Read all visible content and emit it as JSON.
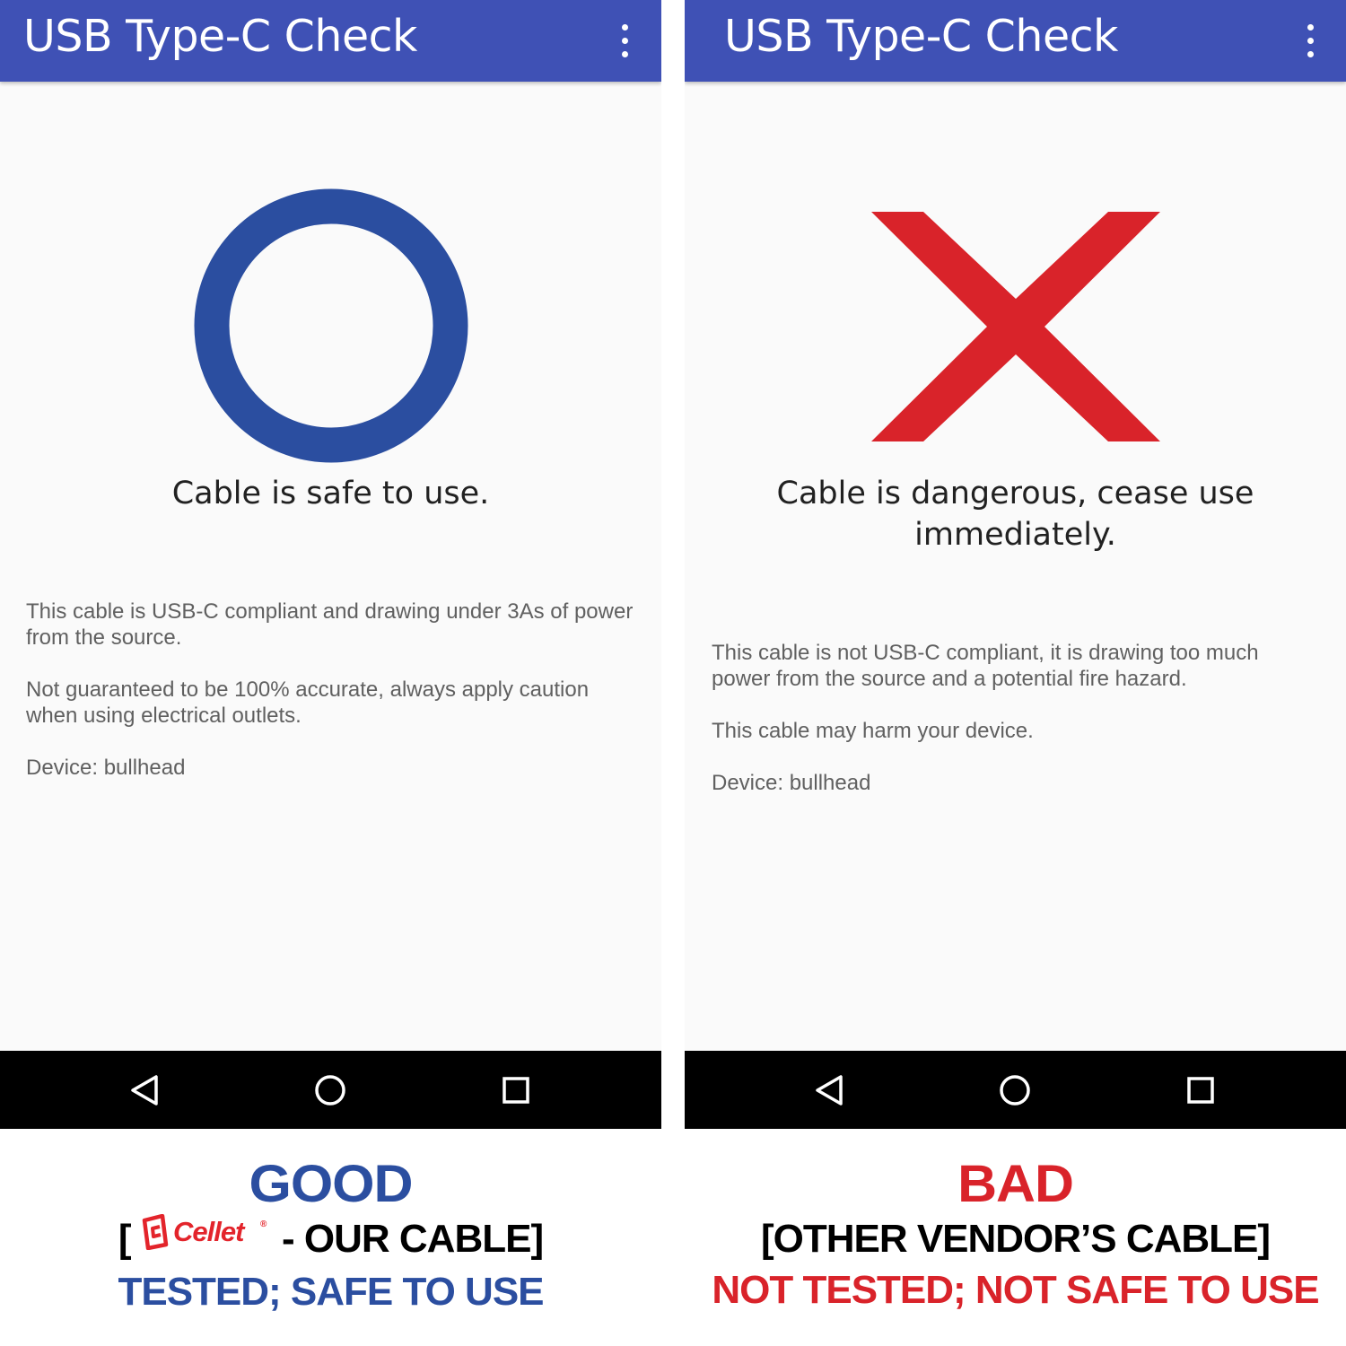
{
  "left_screen": {
    "app_title": "USB Type-C Check",
    "status_icon": "ring-icon",
    "status_color": "#2b4ea0",
    "headline": "Cable is safe to use.",
    "info": [
      "This cable is USB-C compliant and drawing under 3As of power from the source.",
      "Not guaranteed to be 100% accurate, always apply caution when using electrical outlets.",
      "Device: bullhead"
    ]
  },
  "right_screen": {
    "app_title": "USB Type-C Check",
    "status_icon": "cross-icon",
    "status_color": "#d9232a",
    "headline": "Cable is dangerous, cease use immediately.",
    "info": [
      "This cable is not USB-C compliant, it is drawing too much power from the source and a potential fire hazard.",
      "This cable may harm your device.",
      "Device: bullhead"
    ]
  },
  "theme": {
    "app_bar": "#3f51b5",
    "background": "#fafafa",
    "nav_bar": "#000000"
  },
  "nav_icons": [
    "back-icon",
    "home-icon",
    "recents-icon"
  ],
  "captions": {
    "good": {
      "title": "GOOD",
      "bracket_open": "[",
      "brand": "Cellet",
      "brand_mark": "®",
      "label": " - OUR CABLE]",
      "subtitle": "TESTED; SAFE TO USE"
    },
    "bad": {
      "title": "BAD",
      "label": "[OTHER VENDOR’S CABLE]",
      "subtitle": "NOT TESTED; NOT SAFE TO USE"
    }
  }
}
